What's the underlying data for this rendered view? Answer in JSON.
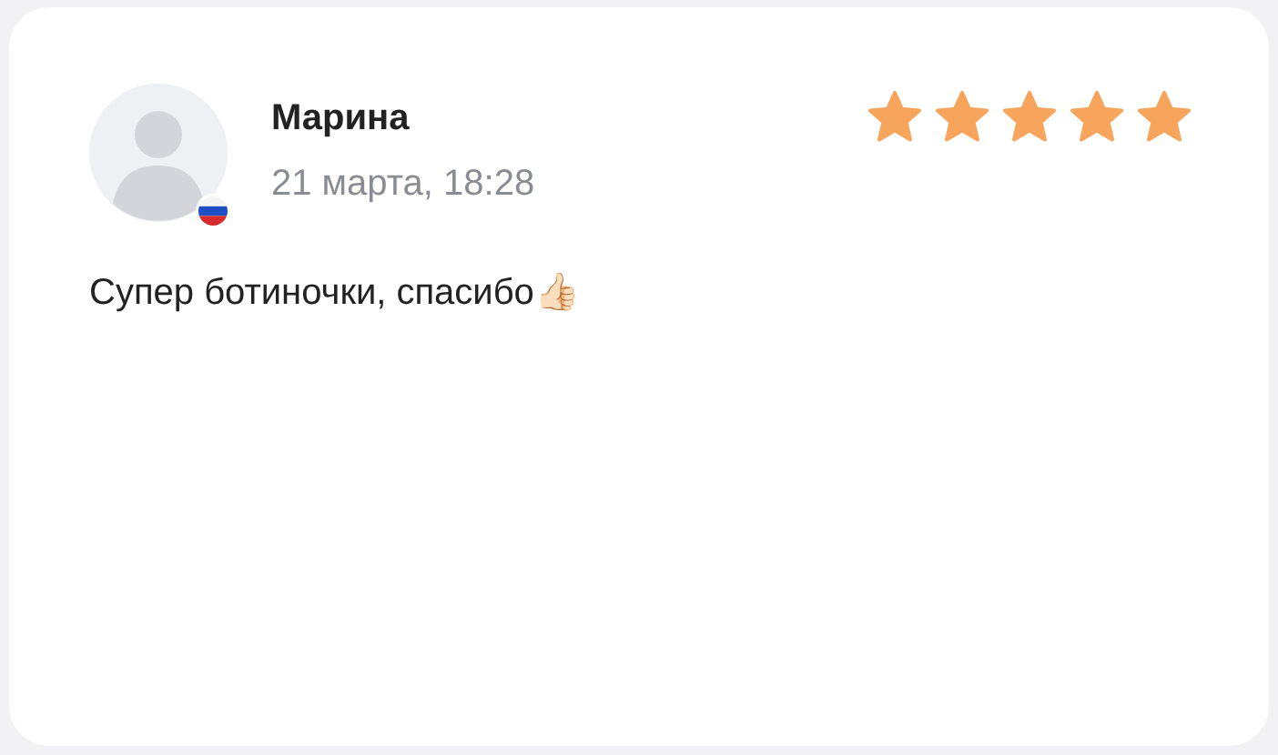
{
  "review": {
    "author": "Марина",
    "date": "21 марта, 18:28",
    "stars": 5,
    "text": "Супер ботиночки, спасибо👍🏻"
  }
}
